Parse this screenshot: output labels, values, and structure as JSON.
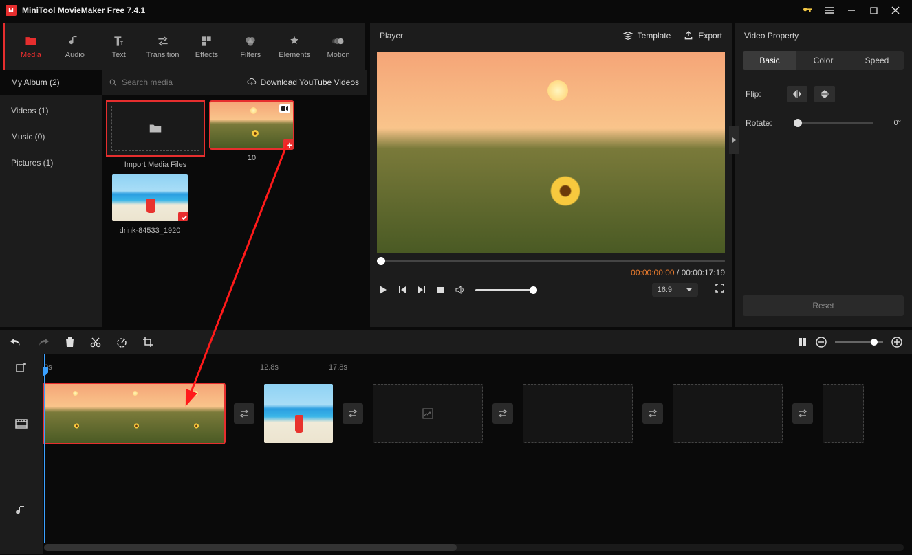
{
  "app": {
    "title": "MiniTool MovieMaker Free 7.4.1"
  },
  "topTabs": [
    {
      "label": "Media",
      "active": true
    },
    {
      "label": "Audio"
    },
    {
      "label": "Text"
    },
    {
      "label": "Transition"
    },
    {
      "label": "Effects"
    },
    {
      "label": "Filters"
    },
    {
      "label": "Elements"
    },
    {
      "label": "Motion"
    }
  ],
  "mediaPanel": {
    "albumTab": "My Album (2)",
    "searchPlaceholder": "Search media",
    "downloadLabel": "Download YouTube Videos",
    "side": [
      {
        "label": "Videos (1)"
      },
      {
        "label": "Music (0)"
      },
      {
        "label": "Pictures (1)"
      }
    ],
    "items": [
      {
        "type": "import",
        "label": "Import Media Files"
      },
      {
        "type": "video",
        "label": "10"
      },
      {
        "type": "image",
        "label": "drink-84533_1920"
      }
    ]
  },
  "player": {
    "label": "Player",
    "templateLabel": "Template",
    "exportLabel": "Export",
    "currentTime": "00:00:00:00",
    "separator": " / ",
    "totalTime": "00:00:17:19",
    "aspect": "16:9"
  },
  "props": {
    "title": "Video Property",
    "tabs": [
      {
        "label": "Basic",
        "active": true
      },
      {
        "label": "Color"
      },
      {
        "label": "Speed"
      }
    ],
    "flipLabel": "Flip:",
    "rotateLabel": "Rotate:",
    "rotateValue": "0°",
    "resetLabel": "Reset"
  },
  "ruler": {
    "labels": [
      {
        "text": "0s",
        "pos": 0
      },
      {
        "text": "12.8s",
        "pos": 316
      },
      {
        "text": "17.8s",
        "pos": 416
      }
    ]
  }
}
